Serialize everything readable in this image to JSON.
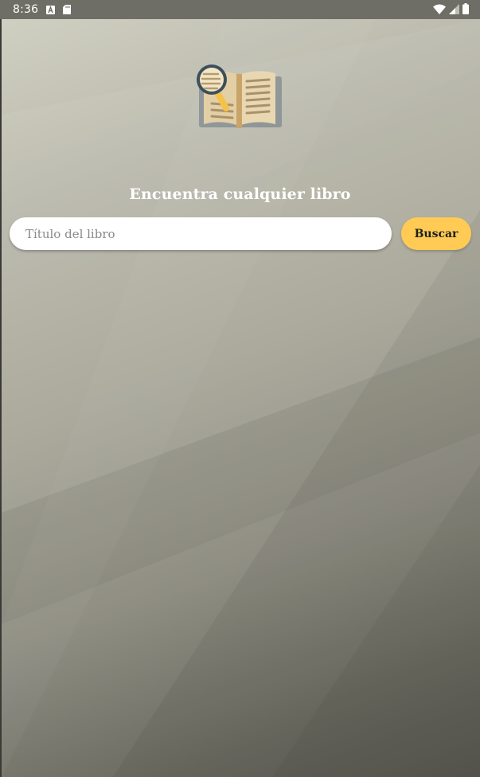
{
  "status_bar": {
    "time": "8:36",
    "left_icons": [
      "notification-a-icon",
      "sd-card-icon"
    ],
    "right_icons": [
      "wifi-icon",
      "signal-icon",
      "battery-icon"
    ]
  },
  "app": {
    "logo_icon": "book-magnifier-icon",
    "headline": "Encuentra cualquier libro",
    "search": {
      "value": "",
      "placeholder": "Título del libro"
    },
    "search_button_label": "Buscar"
  },
  "colors": {
    "status_bar": "#6f6e66",
    "button": "#ffcb55",
    "input_bg": "#ffffff",
    "headline_text": "#ffffff"
  }
}
